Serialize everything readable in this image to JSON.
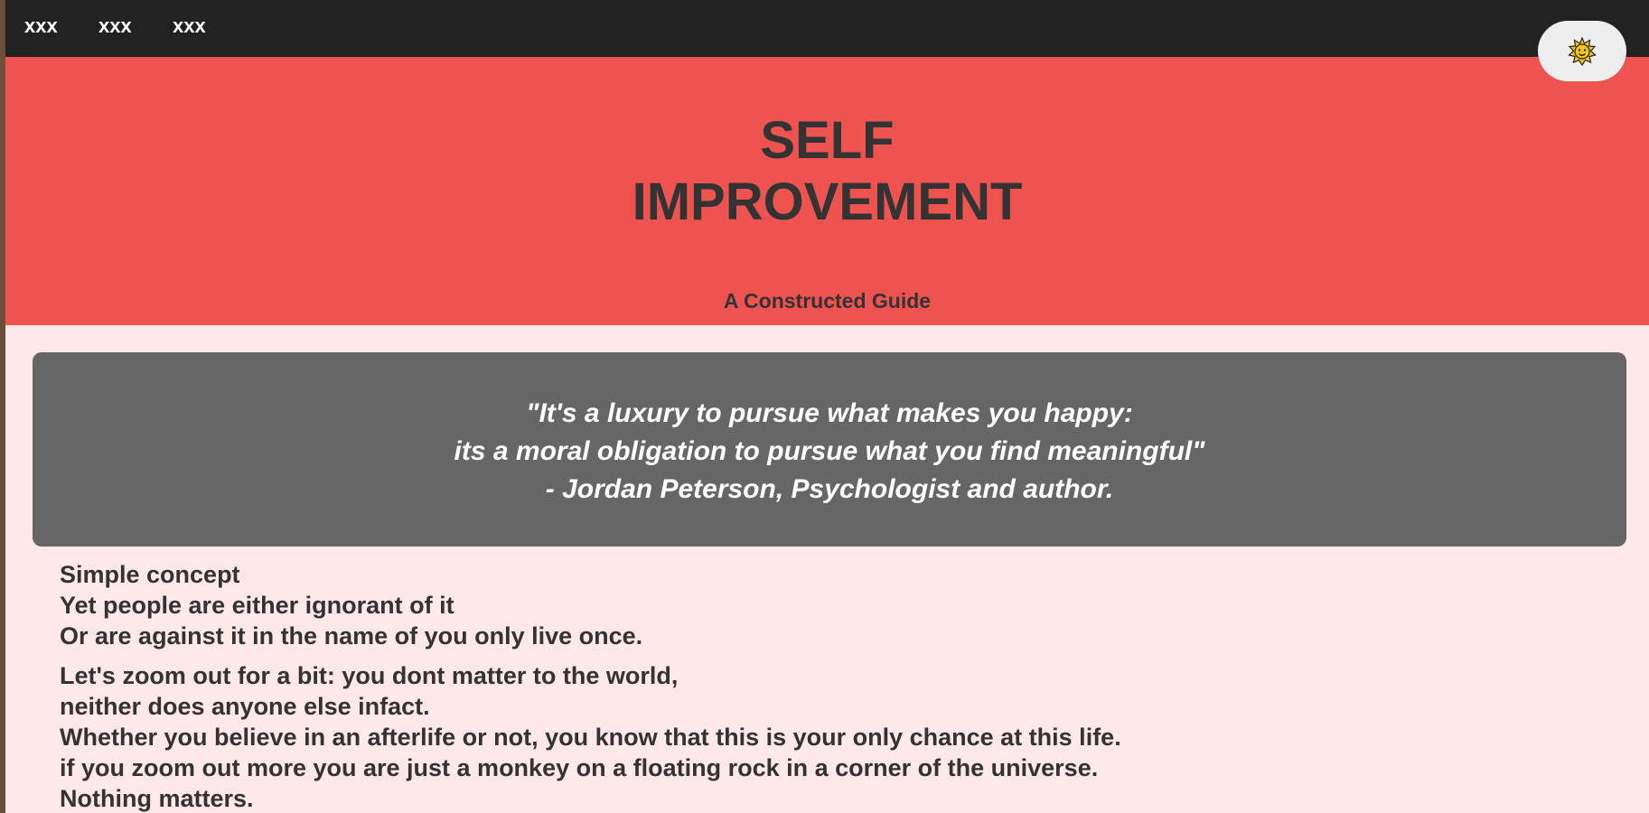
{
  "nav": {
    "links": [
      "xxx",
      "xxx",
      "xxx"
    ],
    "theme_toggle_icon": "sun-icon"
  },
  "hero": {
    "title_line1": "SELF",
    "title_line2": "IMPROVEMENT",
    "subtitle": "A Constructed Guide"
  },
  "quote": {
    "line1": "\"It's a luxury to pursue what makes you happy:",
    "line2": "its a moral obligation to pursue what you find meaningful\"",
    "line3": "- Jordan Peterson, Psychologist and author."
  },
  "content": {
    "paragraph1": [
      "Simple concept",
      "Yet people are either ignorant of it",
      "Or are against it in the name of you only live once."
    ],
    "paragraph2": [
      "Let's zoom out for a bit: you dont matter to the world,",
      "neither does anyone else infact.",
      "Whether you believe in an afterlife or not, you know that this is your only chance at this life.",
      "if you zoom out more you are just a monkey on a floating rock in a corner of the universe.",
      "Nothing matters."
    ]
  },
  "colors": {
    "navbar": "#222222",
    "hero": "#ee5350",
    "page_background": "#ffe8ea",
    "quote_background": "#666666",
    "text": "#333333"
  }
}
